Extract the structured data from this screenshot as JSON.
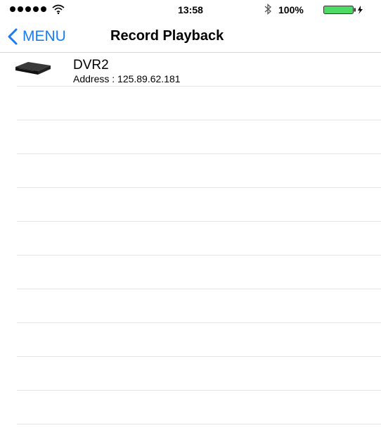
{
  "status_bar": {
    "time": "13:58",
    "battery_percent": "100%",
    "icons": [
      "signal-dots-icon",
      "wifi-icon",
      "bluetooth-icon",
      "battery-charging-icon"
    ]
  },
  "nav": {
    "back_label": "MENU",
    "title": "Record Playback",
    "back_icon": "chevron-left-icon",
    "accent_color": "#1a7cf5"
  },
  "devices": [
    {
      "name": "DVR2",
      "address": "Address : 125.89.62.181",
      "icon": "dvr-box-icon"
    }
  ]
}
